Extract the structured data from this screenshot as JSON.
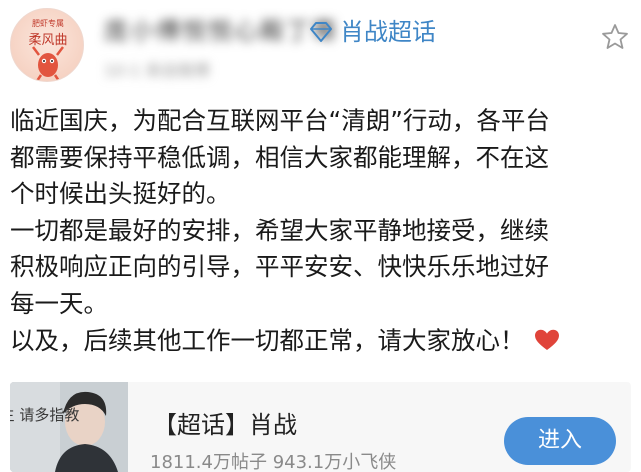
{
  "header": {
    "username": "庞小傅悦悦心殿丁骞",
    "supertopic_label": "肖战超话",
    "meta": "10-1 来自微博",
    "avatar_text": "肥虾专属 柔风曲"
  },
  "post": {
    "lines": [
      "临近国庆，为配合互联网平台“清朗”行动，各平台",
      "都需要保持平稳低调，相信大家都能理解，不在这",
      "个时候出头挺好的。",
      "一切都是最好的安排，希望大家平静地接受，继续",
      "积极响应正向的引导，平平安安、快快乐乐地过好",
      "每一天。",
      "以及，后续其他工作一切都正常，请大家放心！"
    ],
    "emoji": "heart-icon"
  },
  "card": {
    "title": "【超话】肖战",
    "stats": "1811.4万帖子 943.1万小飞侠",
    "join_label": "进入",
    "cover_text": "余生 请多指教"
  },
  "colors": {
    "link_blue": "#3f86c6",
    "button_blue": "#4a90d9",
    "heart_red": "#e0443a"
  }
}
